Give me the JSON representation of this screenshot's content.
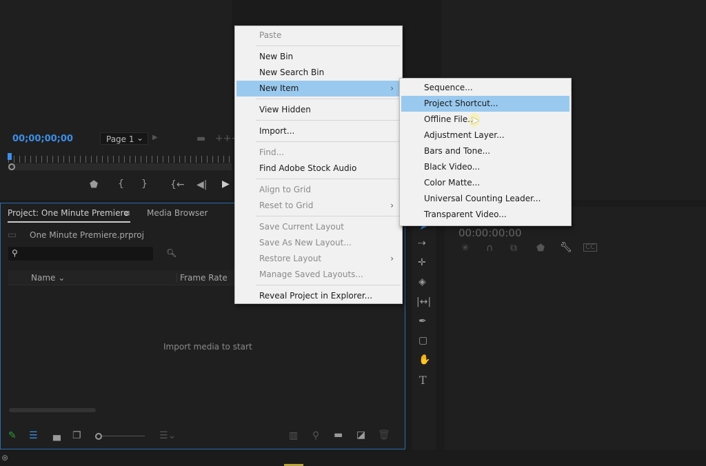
{
  "source_monitor": {
    "timecode": "00;00;00;00",
    "page_select": "Page 1"
  },
  "project_panel": {
    "tab_project": "Project: One Minute Premiere",
    "tab_media_browser": "Media Browser",
    "project_file": "One Minute Premiere.prproj",
    "search_placeholder": "",
    "columns": [
      "Name",
      "Frame Rate"
    ],
    "empty_message": "Import media to start"
  },
  "timeline": {
    "timecode": "00:00:00:00"
  },
  "context_menu": {
    "items": [
      {
        "label": "Paste",
        "disabled": true
      },
      {
        "sep": true
      },
      {
        "label": "New Bin"
      },
      {
        "label": "New Search Bin"
      },
      {
        "label": "New Item",
        "submenu": true,
        "highlighted": true
      },
      {
        "sep": true
      },
      {
        "label": "View Hidden"
      },
      {
        "sep": true
      },
      {
        "label": "Import..."
      },
      {
        "sep": true
      },
      {
        "label": "Find...",
        "disabled": true
      },
      {
        "label": "Find Adobe Stock Audio"
      },
      {
        "sep": true
      },
      {
        "label": "Align to Grid",
        "disabled": true
      },
      {
        "label": "Reset to Grid",
        "disabled": true,
        "submenu": true
      },
      {
        "sep": true
      },
      {
        "label": "Save Current Layout",
        "disabled": true
      },
      {
        "label": "Save As New Layout...",
        "disabled": true
      },
      {
        "label": "Restore Layout",
        "disabled": true,
        "submenu": true
      },
      {
        "label": "Manage Saved Layouts...",
        "disabled": true
      },
      {
        "sep": true
      },
      {
        "label": "Reveal Project in Explorer..."
      }
    ]
  },
  "submenu": {
    "items": [
      {
        "label": "Sequence..."
      },
      {
        "label": "Project Shortcut...",
        "highlighted": true
      },
      {
        "label": "Offline File..."
      },
      {
        "label": "Adjustment Layer..."
      },
      {
        "label": "Bars and Tone..."
      },
      {
        "label": "Black Video..."
      },
      {
        "label": "Color Matte..."
      },
      {
        "label": "Universal Counting Leader..."
      },
      {
        "label": "Transparent Video..."
      }
    ]
  },
  "colors": {
    "accent": "#3d8fe8",
    "menu_highlight": "#99c9ef",
    "menu_bg": "#f1f1f1"
  }
}
